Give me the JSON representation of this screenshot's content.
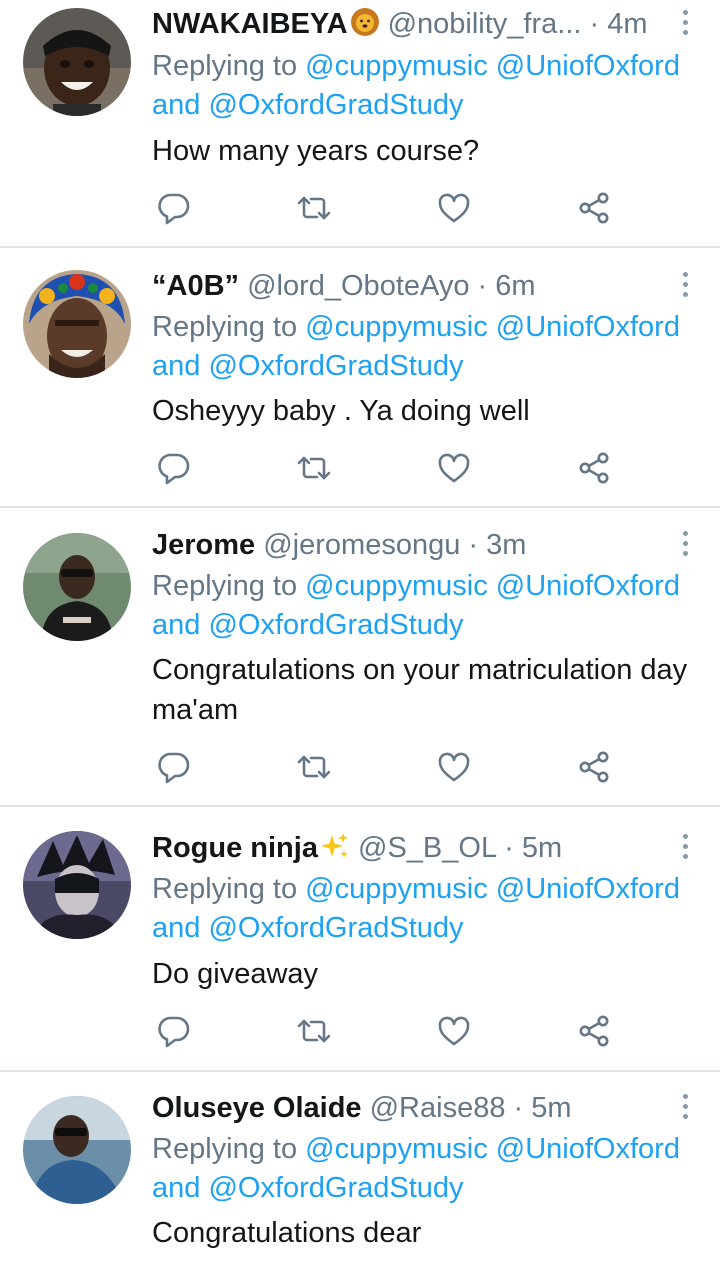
{
  "reply_prefix": "Replying to",
  "mention_1": "@cuppymusic",
  "mention_2": "@UniofOxford",
  "mention_and": "and",
  "mention_3": "@OxfordGradStudy",
  "separator": "·",
  "tweets": [
    {
      "name": "NWAKAIBEYA",
      "emoji": "lion-emoji",
      "handle": "@nobility_fra...",
      "time": "4m",
      "text": "How many years course?"
    },
    {
      "name": "“A0B”",
      "handle": "@lord_ObotеAyo",
      "time": "6m",
      "text": "Osheyyy baby . Ya doing well"
    },
    {
      "name": "Jerome",
      "handle": "@jeromesongu",
      "time": "3m",
      "text": "Congratulations on your matriculation day ma'am"
    },
    {
      "name": "Rogue ninja",
      "emoji": "sparkles-emoji",
      "handle": "@S_B_OL",
      "time": "5m",
      "text": "Do giveaway"
    },
    {
      "name": "Oluseye Olaide",
      "handle": "@Raise88",
      "time": "5m",
      "text": "Congratulations dear"
    }
  ],
  "icons": [
    "reply-icon",
    "retweet-icon",
    "like-icon",
    "share-icon",
    "more-options-icon"
  ],
  "colors": {
    "link": "#1da1f2",
    "muted": "#657786",
    "text": "#14171a",
    "divider": "#e1e4e6"
  }
}
